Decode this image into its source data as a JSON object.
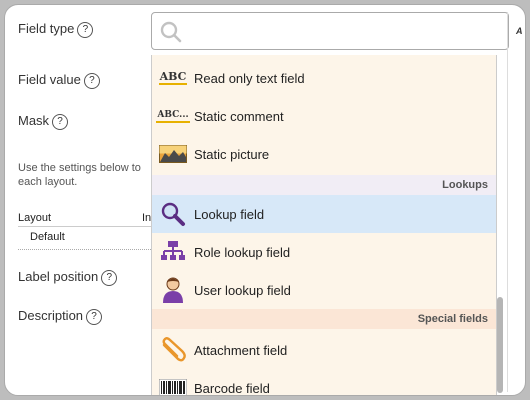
{
  "form": {
    "field_type_label": "Field type",
    "field_value_label": "Field value",
    "mask_label": "Mask",
    "help_glyph": "?",
    "hint_text": "Use the settings below to each layout.",
    "layout_header": "Layout",
    "in_header": "In",
    "layout_value": "Default",
    "label_position_label": "Label position",
    "description_label": "Description"
  },
  "search": {
    "placeholder": ""
  },
  "dropdown": {
    "items_top": [
      {
        "label": "Read only text field",
        "icon": "abc-icon"
      },
      {
        "label": "Static comment",
        "icon": "abc-comment-icon"
      },
      {
        "label": "Static picture",
        "icon": "picture-icon"
      }
    ],
    "group_lookups": "Lookups",
    "items_lookups": [
      {
        "label": "Lookup field",
        "icon": "magnifier-icon",
        "selected": true
      },
      {
        "label": "Role lookup field",
        "icon": "org-chart-icon"
      },
      {
        "label": "User lookup field",
        "icon": "user-icon"
      }
    ],
    "group_special": "Special fields",
    "items_special": [
      {
        "label": "Attachment field",
        "icon": "paperclip-icon"
      },
      {
        "label": "Barcode field",
        "icon": "barcode-icon"
      }
    ]
  },
  "icons": {
    "abc_text": "ABC",
    "abc_comment_text": "ABC..."
  },
  "colors": {
    "dropdown_bg": "#fdf5e9",
    "selected_bg": "#d7e8f8",
    "lookups_header_bg": "#f1edf5",
    "special_header_bg": "#fbe6d6"
  }
}
